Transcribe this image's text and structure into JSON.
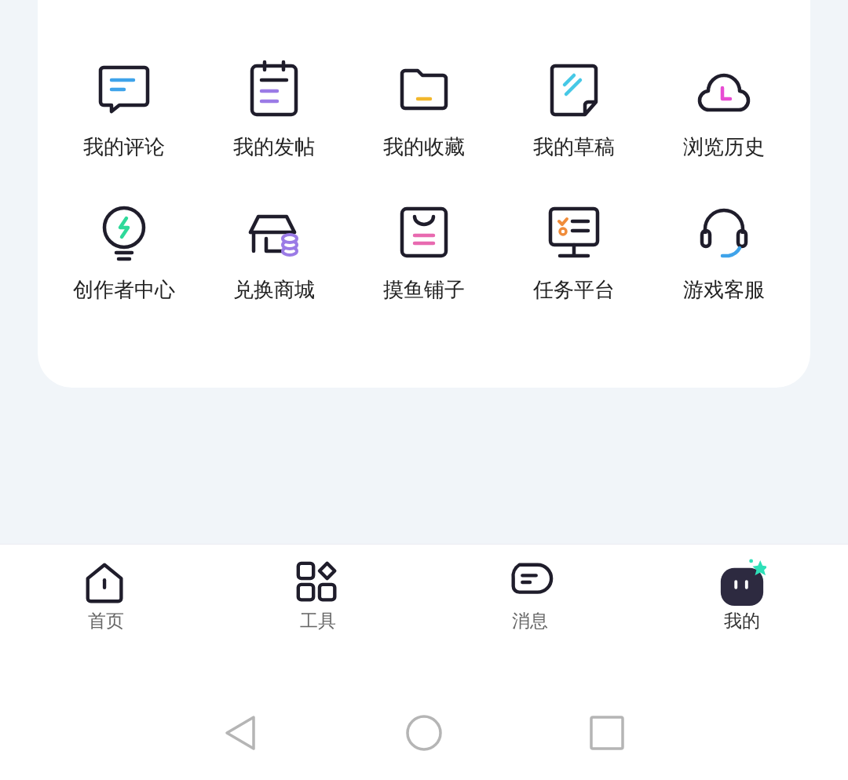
{
  "menu_grid": [
    {
      "label": "我的评论"
    },
    {
      "label": "我的发帖"
    },
    {
      "label": "我的收藏"
    },
    {
      "label": "我的草稿"
    },
    {
      "label": "浏览历史"
    },
    {
      "label": "创作者中心"
    },
    {
      "label": "兑换商城"
    },
    {
      "label": "摸鱼铺子"
    },
    {
      "label": "任务平台"
    },
    {
      "label": "游戏客服"
    }
  ],
  "bottom_nav": [
    {
      "label": "首页",
      "selected": false
    },
    {
      "label": "工具",
      "selected": false
    },
    {
      "label": "消息",
      "selected": false
    },
    {
      "label": "我的",
      "selected": true
    }
  ]
}
